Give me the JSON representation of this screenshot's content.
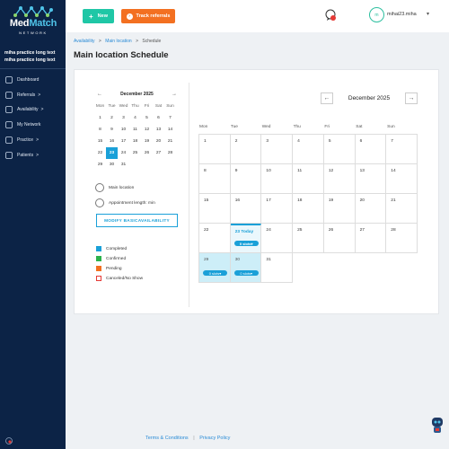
{
  "brand": {
    "name_a": "Med",
    "name_b": "Match",
    "sub": "NETWORK"
  },
  "sidebar": {
    "practice": "miha practice long text miha practice long text",
    "items": [
      {
        "label": "Dashboard",
        "chev": ""
      },
      {
        "label": "Referrals",
        "chev": ">"
      },
      {
        "label": "Availability",
        "chev": ">"
      },
      {
        "label": "My Network",
        "chev": ""
      },
      {
        "label": "Practice",
        "chev": ">"
      },
      {
        "label": "Patients",
        "chev": ">"
      }
    ]
  },
  "topbar": {
    "new_label": "New",
    "track_label": "Track referrals",
    "avatar_initials": "m",
    "username": "mihai23.miha"
  },
  "breadcrumb": {
    "a": "Availability",
    "b": "Main location",
    "c": "Schedule",
    "sep": ">"
  },
  "page": {
    "title": "Main location Schedule"
  },
  "mini_calendar": {
    "month": "December 2025",
    "weekdays": [
      "Mon",
      "Tue",
      "Wed",
      "Thu",
      "Fri",
      "Sat",
      "Sun"
    ],
    "days": [
      "1",
      "2",
      "3",
      "4",
      "5",
      "6",
      "7",
      "8",
      "9",
      "10",
      "11",
      "12",
      "13",
      "14",
      "15",
      "16",
      "17",
      "18",
      "19",
      "20",
      "21",
      "22",
      "23",
      "24",
      "25",
      "26",
      "27",
      "28",
      "29",
      "30",
      "31"
    ],
    "selected": "23"
  },
  "info": {
    "location": "Main location",
    "appointment_length": "Appointment length: min"
  },
  "modify_button": {
    "line1": "MODIFY BASIC",
    "line2": "AVAILABILITY"
  },
  "legend": [
    {
      "label": "Completed",
      "color": "#1aa0d8"
    },
    {
      "label": "Confirmed",
      "color": "#2bb24c"
    },
    {
      "label": "Pending",
      "color": "#f37021"
    },
    {
      "label": "Canceled/No Show",
      "color": "#e53935"
    }
  ],
  "calendar": {
    "month": "December 2025",
    "weekdays": [
      "Mon",
      "Tue",
      "Wed",
      "Thu",
      "Fri",
      "Sat",
      "Sun"
    ],
    "cells": [
      {
        "label": "1"
      },
      {
        "label": "2"
      },
      {
        "label": "3"
      },
      {
        "label": "4"
      },
      {
        "label": "5"
      },
      {
        "label": "6"
      },
      {
        "label": "7"
      },
      {
        "label": "8"
      },
      {
        "label": "9"
      },
      {
        "label": "10"
      },
      {
        "label": "11"
      },
      {
        "label": "12"
      },
      {
        "label": "13"
      },
      {
        "label": "14"
      },
      {
        "label": "15"
      },
      {
        "label": "16"
      },
      {
        "label": "17"
      },
      {
        "label": "18"
      },
      {
        "label": "19"
      },
      {
        "label": "20"
      },
      {
        "label": "21"
      },
      {
        "label": "22"
      },
      {
        "label": "23 Today",
        "state": "today",
        "slots": "0 slots▾"
      },
      {
        "label": "24"
      },
      {
        "label": "25"
      },
      {
        "label": "26"
      },
      {
        "label": "27"
      },
      {
        "label": "28"
      },
      {
        "label": "29",
        "state": "future",
        "slots": "0 slots▾"
      },
      {
        "label": "30",
        "state": "future",
        "slots": "0 slots▾"
      },
      {
        "label": "31"
      }
    ]
  },
  "footer": {
    "terms": "Terms & Conditions",
    "sep": "|",
    "privacy": "Privacy Policy"
  },
  "colors": {
    "sidebar": "#0c2346",
    "accent": "#1aa0d8",
    "new": "#1fc7a6",
    "track": "#f37021"
  }
}
